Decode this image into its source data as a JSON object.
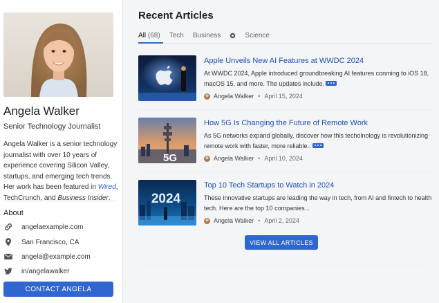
{
  "profile": {
    "name": "Angela Walker",
    "role": "Senior Technology Journalist",
    "bio_part1": "Angela Walker is a senior technology journalist with over 10 years of experience covering Silicon Valley, startups, and emerging tech trends. Her work has been featured in ",
    "bio_pub1": "Wired",
    "bio_sep1": ", ",
    "bio_pub2": "TechCrunch",
    "bio_sep2": ", and ",
    "bio_pub3": "Business Insider",
    "bio_end": ".",
    "about_heading": "About",
    "website": "angelaexample.com",
    "location": "San Francisco, CA",
    "email": "angela@example.com",
    "twitter": "in/angelawalker",
    "contact_button": "CONTACT ANGELA"
  },
  "main": {
    "section_title": "Recent Articles",
    "tabs": [
      {
        "label": "All",
        "count": "(68)"
      },
      {
        "label": "Tech"
      },
      {
        "label": "Business"
      },
      {
        "label": "Science"
      }
    ],
    "articles": [
      {
        "title": "Apple Unveils New AI Features at WWDC 2024",
        "excerpt": "At WWDC 2024, Apple introduced groundbreaking AI features conming to iOS 18, macOS 15, and more. The updates include.",
        "author": "Angela Walker",
        "date": "April 15, 2024",
        "thumb_icon": "apple-logo-icon"
      },
      {
        "title": "How 5G Is Changing the Future of Remote Work",
        "excerpt": "As 5G networks expand globally, discover how this techolnology is revolutionizing remote work with faster, more reliable..",
        "author": "Angela Walker",
        "date": "April 10, 2024",
        "thumb_text": "5G"
      },
      {
        "title": "Top 10 Tech Startups to Watch in 2024",
        "excerpt": "These innovative startups are leading the way in tech, from AI and fintech to health tech. Here are the top 10 companies...",
        "author": "Angela Walker",
        "date": "April 2, 2024",
        "thumb_text": "2024"
      }
    ],
    "view_all_button": "VIEW ALL ARTICLES"
  },
  "colors": {
    "accent": "#2f66cf",
    "link": "#1f4fb5",
    "sidebar_bg": "#ffffff",
    "page_bg": "#f4f5f7"
  }
}
